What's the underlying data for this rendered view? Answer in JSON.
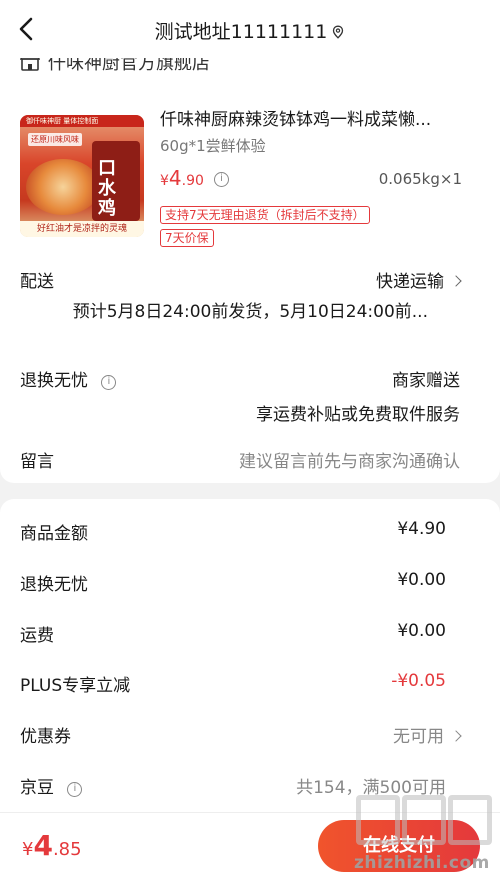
{
  "header": {
    "title": "测试地址11111111",
    "back_icon": "chevron-left-icon",
    "pin_icon": "location-pin-icon"
  },
  "shop": {
    "name": "仟味神厨官方旗舰店",
    "icon": "store-icon"
  },
  "product": {
    "name": "仟味神厨麻辣烫钵钵鸡一料成菜懒...",
    "spec": "60g*1尝鲜体验",
    "price_currency": "¥",
    "price_int": "4",
    "price_dec": ".90",
    "weight_qty": "0.065kg×1",
    "tags": [
      "支持7天无理由退货（拆封后不支持）",
      "7天价保"
    ],
    "image_texts": {
      "band": "御仟味神厨 量体控制面",
      "tag": "还原川味风味",
      "pack": "口水鸡",
      "caption": "好红油才是凉拌的灵魂"
    }
  },
  "delivery": {
    "label": "配送",
    "method": "快递运输",
    "estimate": "预计5月8日24:00前发货，5月10日24:00前..."
  },
  "worry_free": {
    "label": "退换无忧",
    "value": "商家赠送",
    "desc": "享运费补贴或免费取件服务"
  },
  "message": {
    "label": "留言",
    "placeholder": "建议留言前先与商家沟通确认"
  },
  "summary": {
    "goods_label": "商品金额",
    "goods_value": "¥4.90",
    "worry_label": "退换无忧",
    "worry_value": "¥0.00",
    "freight_label": "运费",
    "freight_value": "¥0.00",
    "plus_label": "PLUS专享立减",
    "plus_value": "-¥0.05",
    "coupon_label": "优惠券",
    "coupon_value": "无可用",
    "jingdou_label": "京豆",
    "jingdou_value": "共154，满500可用"
  },
  "footer": {
    "total_currency": "¥",
    "total_int": "4",
    "total_dec": ".85",
    "pay_button": "在线支付"
  },
  "watermark": {
    "text": "zhizhizhi.com"
  },
  "colors": {
    "accent": "#e4393c",
    "text": "#1a1a1a",
    "muted": "#888888",
    "background": "#f2f2f2"
  }
}
